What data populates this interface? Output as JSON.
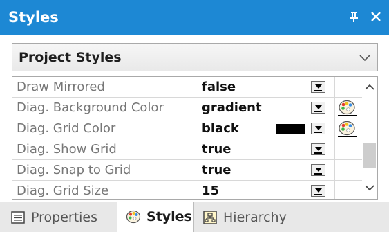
{
  "window": {
    "title": "Styles",
    "pin_glyph": "Ȩ",
    "close_glyph": "✕"
  },
  "style_selector": {
    "selected": "Project Styles"
  },
  "properties": [
    {
      "name": "Draw Mirrored",
      "value": "false",
      "swatch": null,
      "palette": false
    },
    {
      "name": "Diag. Background Color",
      "value": "gradient",
      "swatch": null,
      "palette": true
    },
    {
      "name": "Diag. Grid Color",
      "value": "black",
      "swatch": "#000000",
      "palette": true
    },
    {
      "name": "Diag. Show Grid",
      "value": "true",
      "swatch": null,
      "palette": false
    },
    {
      "name": "Diag. Snap to Grid",
      "value": "true",
      "swatch": null,
      "palette": false
    },
    {
      "name": "Diag. Grid Size",
      "value": "15",
      "swatch": null,
      "palette": false
    }
  ],
  "tabs": [
    {
      "label": "Properties",
      "icon": "properties-icon",
      "active": false
    },
    {
      "label": "Styles",
      "icon": "palette-icon",
      "active": true
    },
    {
      "label": "Hierarchy",
      "icon": "hierarchy-icon",
      "active": false
    }
  ],
  "colors": {
    "titlebar": "#1d88d4",
    "property_name_text": "#777777",
    "value_text": "#111111"
  }
}
